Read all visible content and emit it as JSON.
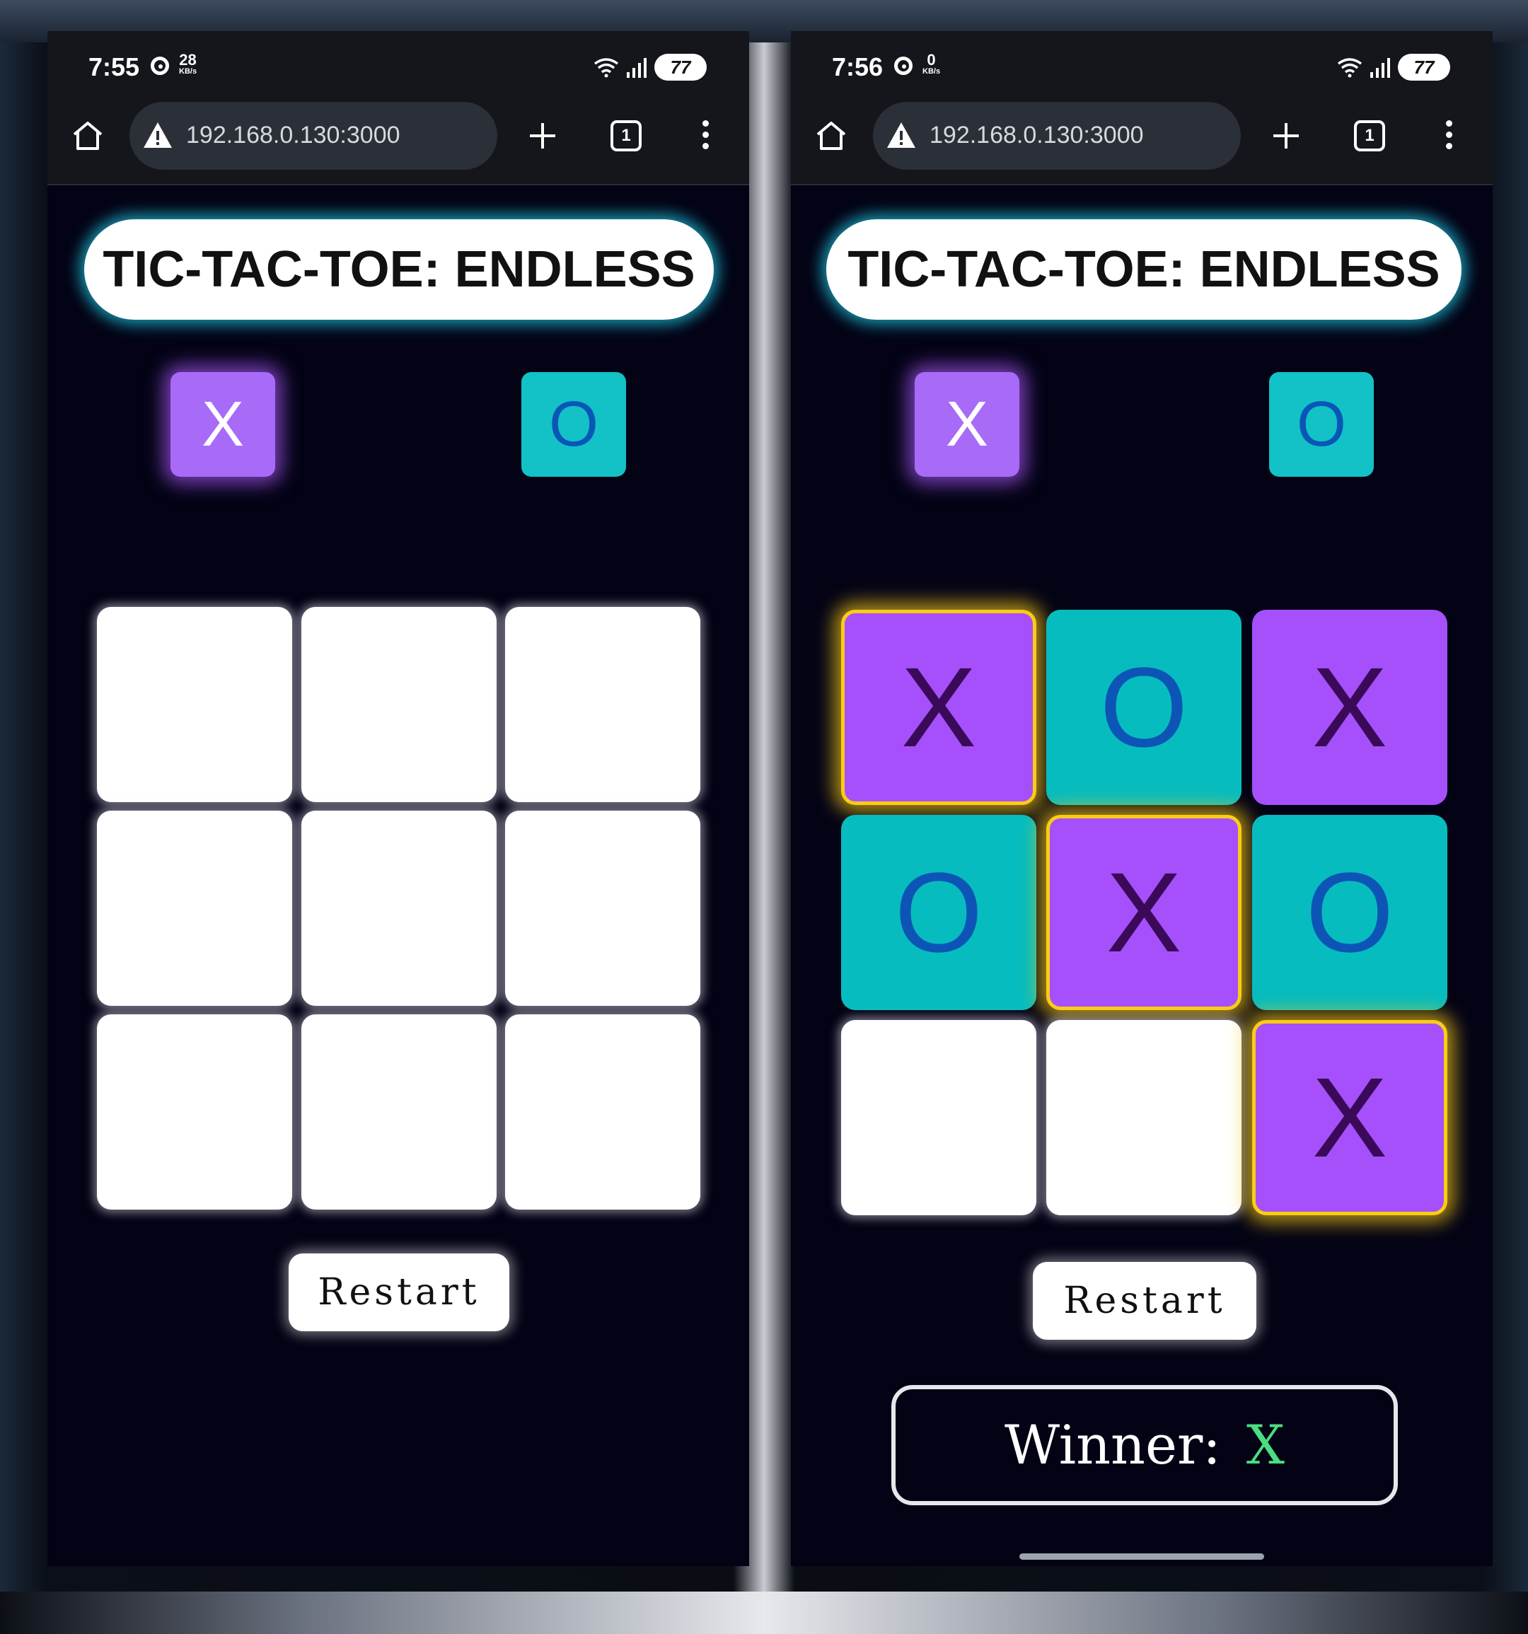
{
  "colors": {
    "x_accent": "#a855f7",
    "o_accent": "#06b6d4",
    "win_highlight": "#facc15",
    "winner_text": "#4ade80",
    "title_glow": "#22d3ee",
    "page_background": "#030315"
  },
  "screens": [
    {
      "status": {
        "time": "7:55",
        "net_speed": "28",
        "net_unit": "KB/s",
        "battery": "77"
      },
      "browser": {
        "url": "192.168.0.130:3000",
        "tab_count": "1"
      },
      "title": "TIC-TAC-TOE: ENDLESS",
      "players": {
        "x_label": "X",
        "o_label": "O",
        "active": "X"
      },
      "board": [
        "",
        "",
        "",
        "",
        "",
        "",
        "",
        "",
        ""
      ],
      "winning_cells": [],
      "restart_label": "Restart"
    },
    {
      "status": {
        "time": "7:56",
        "net_speed": "0",
        "net_unit": "KB/s",
        "battery": "77"
      },
      "browser": {
        "url": "192.168.0.130:3000",
        "tab_count": "1"
      },
      "title": "TIC-TAC-TOE: ENDLESS",
      "players": {
        "x_label": "X",
        "o_label": "O",
        "active": "X"
      },
      "board": [
        "X",
        "O",
        "X",
        "O",
        "X",
        "O",
        "",
        "",
        "X"
      ],
      "winning_cells": [
        0,
        4,
        8
      ],
      "restart_label": "Restart",
      "winner_label": "Winner:",
      "winner_value": "X"
    }
  ]
}
